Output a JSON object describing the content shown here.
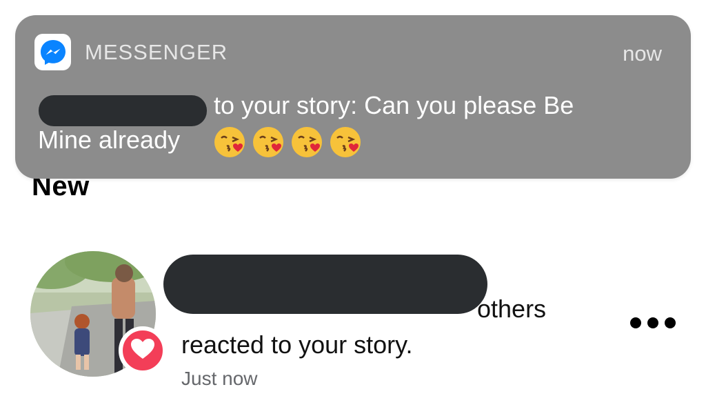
{
  "notification": {
    "app_name": "MESSENGER",
    "time": "now",
    "message_line1": "to your story: Can you please Be",
    "message_line2": "Mine already",
    "emoji_count": 4,
    "emoji_name": "face-blowing-a-kiss"
  },
  "page": {
    "section_title": "New",
    "item": {
      "line1": "others",
      "line2": "reacted to your story.",
      "time": "Just now"
    }
  },
  "colors": {
    "banner_bg": "#8c8c8c",
    "redaction": "#2a2d30",
    "reaction_badge": "#f33e58",
    "messenger_blue": "#0a84ff"
  }
}
